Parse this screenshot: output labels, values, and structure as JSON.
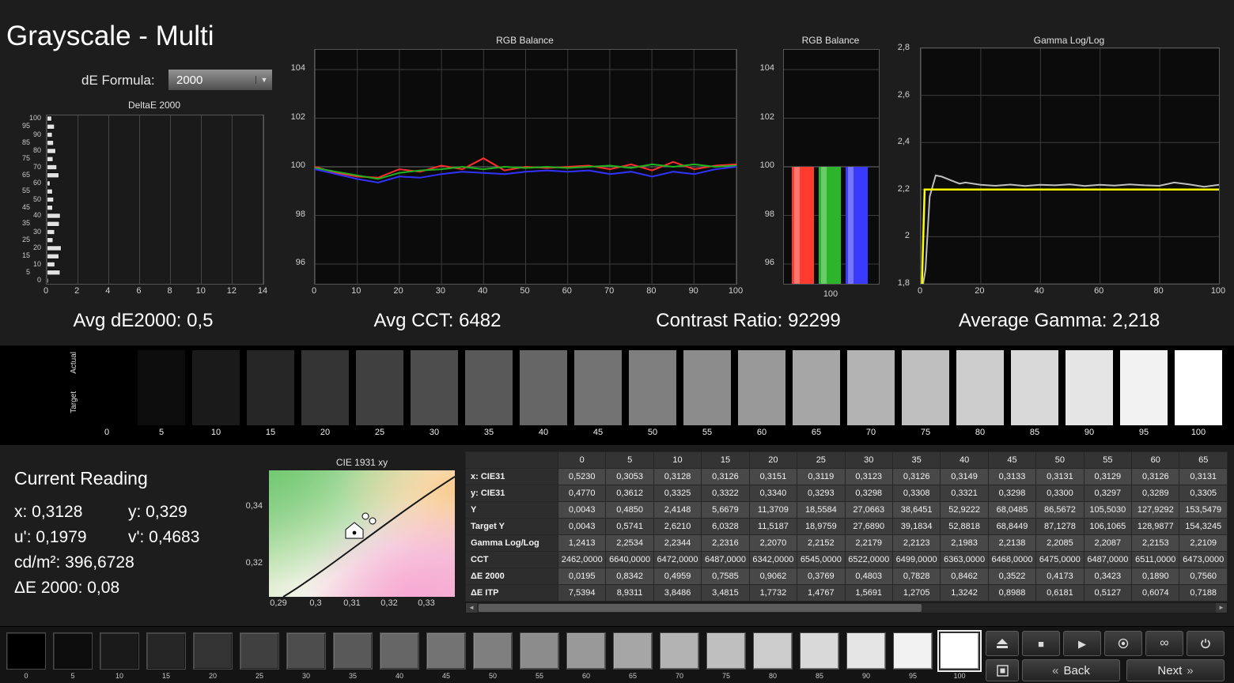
{
  "window": {
    "title": "Grayscale - Multi"
  },
  "de_formula": {
    "label": "dE Formula:",
    "value": "2000"
  },
  "charts": {
    "deltae": {
      "title": "DeltaE 2000",
      "x_max": 14,
      "x_ticks": [
        0,
        2,
        4,
        6,
        8,
        10,
        12,
        14
      ],
      "levels": [
        0,
        5,
        10,
        15,
        20,
        25,
        30,
        35,
        40,
        45,
        50,
        55,
        60,
        65,
        70,
        75,
        80,
        85,
        90,
        95,
        100
      ],
      "values": [
        0.0195,
        0.8342,
        0.4959,
        0.7585,
        0.9062,
        0.3769,
        0.4803,
        0.7828,
        0.8462,
        0.3522,
        0.4173,
        0.3423,
        0.189,
        0.756,
        0.62,
        0.38,
        0.55,
        0.41,
        0.33,
        0.47,
        0.29
      ]
    },
    "rgb_line": {
      "title": "RGB Balance",
      "y_ticks": [
        104,
        102,
        100,
        98,
        96
      ],
      "x_ticks": [
        0,
        10,
        20,
        30,
        40,
        50,
        60,
        70,
        80,
        90,
        100
      ],
      "x": [
        0,
        5,
        10,
        15,
        20,
        25,
        30,
        35,
        40,
        45,
        50,
        55,
        60,
        65,
        70,
        75,
        80,
        85,
        90,
        95,
        100
      ],
      "series": [
        {
          "name": "red",
          "color": "#ff2d2d",
          "values": [
            100.0,
            99.75,
            99.6,
            99.55,
            99.9,
            99.8,
            100.05,
            99.9,
            100.35,
            99.85,
            100.0,
            99.95,
            100.0,
            100.05,
            99.9,
            100.1,
            99.85,
            100.2,
            99.9,
            100.05,
            100.1
          ]
        },
        {
          "name": "green",
          "color": "#1fb41f",
          "values": [
            99.95,
            99.8,
            99.65,
            99.5,
            99.75,
            99.85,
            99.9,
            100.0,
            99.9,
            100.0,
            99.95,
            100.0,
            99.95,
            100.0,
            100.05,
            99.95,
            100.1,
            100.0,
            100.1,
            100.0,
            100.05
          ]
        },
        {
          "name": "blue",
          "color": "#3232ff",
          "values": [
            99.9,
            99.7,
            99.5,
            99.35,
            99.6,
            99.55,
            99.7,
            99.8,
            99.75,
            99.7,
            99.8,
            99.85,
            99.8,
            99.85,
            99.7,
            99.8,
            99.6,
            99.8,
            99.7,
            99.9,
            100.0
          ]
        }
      ]
    },
    "rgb_bars": {
      "title": "RGB Balance",
      "y_ticks": [
        104,
        102,
        100,
        98,
        96
      ],
      "x_label": "100",
      "bars": [
        {
          "name": "red",
          "color": "#ff3b30",
          "value": 100
        },
        {
          "name": "green",
          "color": "#2cb52c",
          "value": 100
        },
        {
          "name": "blue",
          "color": "#3a3aff",
          "value": 100
        }
      ]
    },
    "gamma": {
      "title": "Gamma Log/Log",
      "y_min": 1.8,
      "y_max": 2.8,
      "y_ticks": [
        "2,8",
        "2,6",
        "2,4",
        "2,2",
        "2",
        "1,8"
      ],
      "y_tick_values": [
        2.8,
        2.6,
        2.4,
        2.2,
        2.0,
        1.8
      ],
      "x_ticks": [
        0,
        20,
        40,
        60,
        80,
        100
      ],
      "target": {
        "name": "target",
        "color": "#ffff00",
        "points": [
          [
            0.4,
            1.8
          ],
          [
            1.3,
            2.2
          ],
          [
            100,
            2.2
          ]
        ]
      },
      "measured": {
        "name": "measured",
        "color": "#bdbdbd",
        "points": [
          [
            0.8,
            1.8
          ],
          [
            1.6,
            1.86
          ],
          [
            3,
            2.17
          ],
          [
            5,
            2.26
          ],
          [
            7,
            2.255
          ],
          [
            10,
            2.24
          ],
          [
            13,
            2.225
          ],
          [
            15,
            2.23
          ],
          [
            20,
            2.22
          ],
          [
            25,
            2.216
          ],
          [
            30,
            2.221
          ],
          [
            35,
            2.215
          ],
          [
            40,
            2.22
          ],
          [
            45,
            2.218
          ],
          [
            50,
            2.222
          ],
          [
            55,
            2.215
          ],
          [
            60,
            2.22
          ],
          [
            65,
            2.217
          ],
          [
            70,
            2.222
          ],
          [
            75,
            2.218
          ],
          [
            80,
            2.216
          ],
          [
            85,
            2.23
          ],
          [
            90,
            2.222
          ],
          [
            95,
            2.212
          ],
          [
            100,
            2.22
          ]
        ]
      }
    }
  },
  "stats": [
    {
      "text": "Avg dE2000: 0,5"
    },
    {
      "text": "Avg CCT: 6482"
    },
    {
      "text": "Contrast Ratio: 92299"
    },
    {
      "text": "Average Gamma: 2,218"
    }
  ],
  "strip": {
    "actual_label": "Actual",
    "target_label": "Target",
    "levels": [
      0,
      5,
      10,
      15,
      20,
      25,
      30,
      35,
      40,
      45,
      50,
      55,
      60,
      65,
      70,
      75,
      80,
      85,
      90,
      95,
      100
    ]
  },
  "current_reading": {
    "title": "Current Reading",
    "x": "x: 0,3128",
    "y": "y: 0,329",
    "u": "u': 0,1979",
    "v": "v': 0,4683",
    "luminance": "cd/m²: 396,6728",
    "de": "ΔE 2000: 0,08"
  },
  "cie": {
    "title": "CIE 1931 xy",
    "y_ticks": [
      "0,34",
      "0,32"
    ],
    "x_ticks": [
      "0,29",
      "0,3",
      "0,31",
      "0,32",
      "0,33"
    ]
  },
  "table": {
    "columns": [
      "0",
      "5",
      "10",
      "15",
      "20",
      "25",
      "30",
      "35",
      "40",
      "45",
      "50",
      "55",
      "60",
      "65"
    ],
    "rows": [
      {
        "label": "x: CIE31",
        "values": [
          "0,5230",
          "0,3053",
          "0,3128",
          "0,3126",
          "0,3151",
          "0,3119",
          "0,3123",
          "0,3126",
          "0,3149",
          "0,3133",
          "0,3131",
          "0,3129",
          "0,3126",
          "0,3131"
        ]
      },
      {
        "label": "y: CIE31",
        "values": [
          "0,4770",
          "0,3612",
          "0,3325",
          "0,3322",
          "0,3340",
          "0,3293",
          "0,3298",
          "0,3308",
          "0,3321",
          "0,3298",
          "0,3300",
          "0,3297",
          "0,3289",
          "0,3305"
        ]
      },
      {
        "label": "Y",
        "values": [
          "0,0043",
          "0,4850",
          "2,4148",
          "5,6679",
          "11,3709",
          "18,5584",
          "27,0663",
          "38,6451",
          "52,9222",
          "68,0485",
          "86,5672",
          "105,5030",
          "127,9292",
          "153,5479"
        ]
      },
      {
        "label": "Target Y",
        "values": [
          "0,0043",
          "0,5741",
          "2,6210",
          "6,0328",
          "11,5187",
          "18,9759",
          "27,6890",
          "39,1834",
          "52,8818",
          "68,8449",
          "87,1278",
          "106,1065",
          "128,9877",
          "154,3245"
        ]
      },
      {
        "label": "Gamma Log/Log",
        "values": [
          "1,2413",
          "2,2534",
          "2,2344",
          "2,2316",
          "2,2070",
          "2,2152",
          "2,2179",
          "2,2123",
          "2,1983",
          "2,2138",
          "2,2085",
          "2,2087",
          "2,2153",
          "2,2109"
        ]
      },
      {
        "label": "CCT",
        "values": [
          "2462,0000",
          "6640,0000",
          "6472,0000",
          "6487,0000",
          "6342,0000",
          "6545,0000",
          "6522,0000",
          "6499,0000",
          "6363,0000",
          "6468,0000",
          "6475,0000",
          "6487,0000",
          "6511,0000",
          "6473,0000"
        ]
      },
      {
        "label": "ΔE 2000",
        "values": [
          "0,0195",
          "0,8342",
          "0,4959",
          "0,7585",
          "0,9062",
          "0,3769",
          "0,4803",
          "0,7828",
          "0,8462",
          "0,3522",
          "0,4173",
          "0,3423",
          "0,1890",
          "0,7560"
        ]
      },
      {
        "label": "ΔE ITP",
        "values": [
          "7,5394",
          "8,9311",
          "3,8486",
          "3,4815",
          "1,7732",
          "1,4767",
          "1,5691",
          "1,2705",
          "1,3242",
          "0,8988",
          "0,6181",
          "0,5127",
          "0,6074",
          "0,7188"
        ]
      }
    ]
  },
  "toolbar": {
    "patch_levels": [
      0,
      5,
      10,
      15,
      20,
      25,
      30,
      35,
      40,
      45,
      50,
      55,
      60,
      65,
      70,
      75,
      80,
      85,
      90,
      95,
      100
    ],
    "selected_level": 100,
    "back_chevron": "«",
    "back_label": "Back",
    "next_label": "Next",
    "next_chevron": "»",
    "loop_icon": "∞"
  }
}
